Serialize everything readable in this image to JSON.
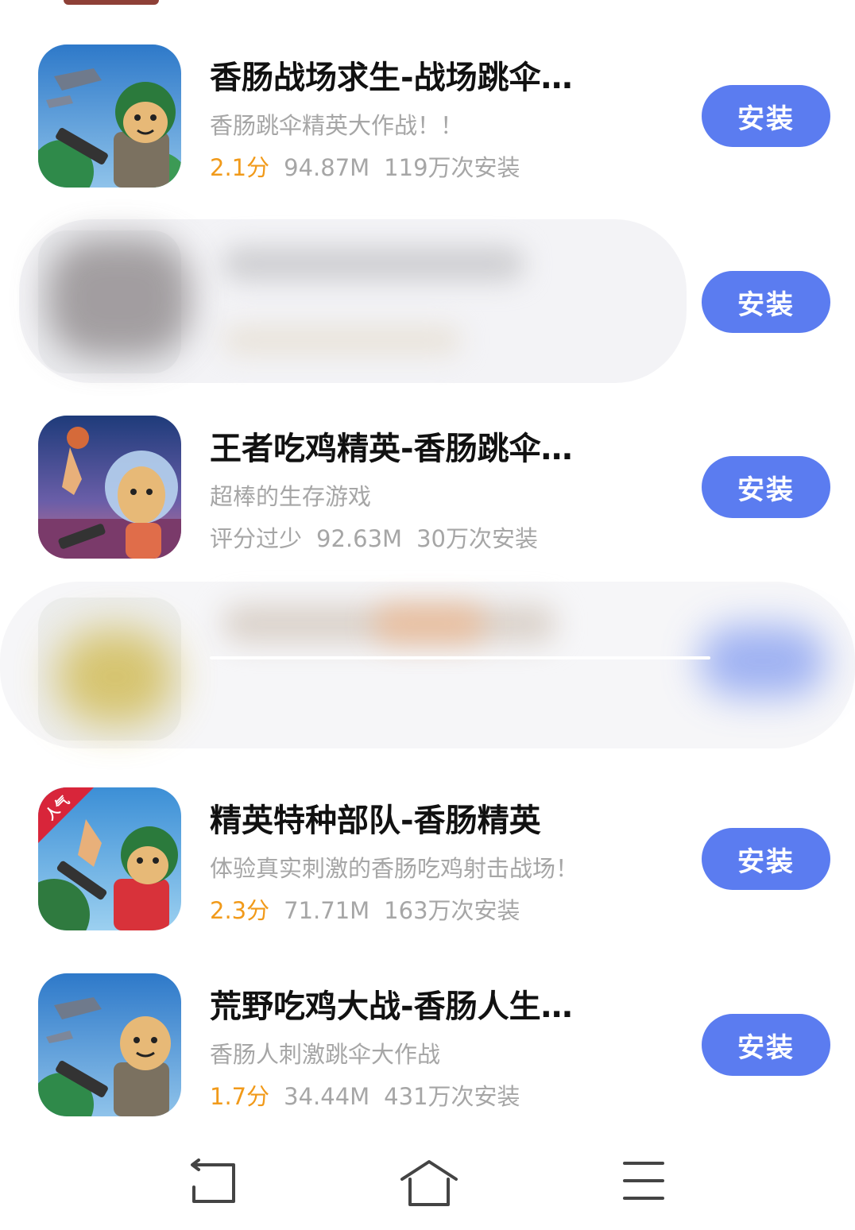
{
  "apps": [
    {
      "title": "香肠战场求生-战场跳伞…",
      "description": "香肠跳伞精英大作战！！",
      "rating": "2.1分",
      "size": "94.87M",
      "installs": "119万次安装",
      "button": "安装"
    },
    {
      "title": "",
      "description": "",
      "rating": "",
      "size": "",
      "installs": "",
      "button": "安装"
    },
    {
      "title": "王者吃鸡精英-香肠跳伞…",
      "description": "超棒的生存游戏",
      "rating": "评分过少",
      "size": "92.63M",
      "installs": "30万次安装",
      "button": "安装"
    },
    {
      "title": "精英特种部队-香肠精英",
      "description": "体验真实刺激的香肠吃鸡射击战场！",
      "rating": "2.3分",
      "size": "71.71M",
      "installs": "163万次安装",
      "button": "安装",
      "icon_badge": "人气"
    },
    {
      "title": "荒野吃鸡大战-香肠人生…",
      "description": "香肠人刺激跳伞大作战",
      "rating": "1.7分",
      "size": "34.44M",
      "installs": "431万次安装",
      "button": "安装"
    }
  ],
  "colors": {
    "accent": "#5b7cf0",
    "rating": "#f19a1a",
    "secondary_text": "#a6a6a6"
  },
  "navbar": {
    "icons": [
      "back-icon",
      "home-icon",
      "menu-icon"
    ]
  }
}
